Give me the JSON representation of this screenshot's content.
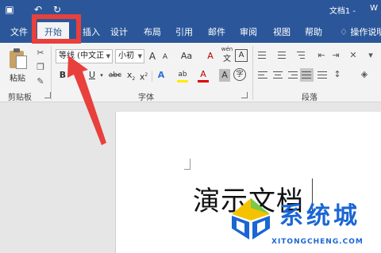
{
  "titlebar": {
    "title": "文档1 -",
    "title_suffix": "W",
    "icons": [
      "save-icon",
      "undo-icon",
      "redo-icon"
    ]
  },
  "tabs": [
    "文件",
    "开始",
    "插入",
    "设计",
    "布局",
    "引用",
    "邮件",
    "审阅",
    "视图",
    "帮助"
  ],
  "active_tab": "开始",
  "tell_me": "操作说明",
  "ribbon": {
    "clipboard": {
      "paste_label": "粘贴",
      "group_label": "剪贴板"
    },
    "font": {
      "font_name": "等线 (中文正",
      "font_size": "小初",
      "grow": "A",
      "shrink": "A",
      "case": "Aa",
      "clear": "A",
      "phonetic": "wén",
      "phonetic_glyph": "文",
      "bold": "B",
      "italic": "I",
      "underline": "U",
      "strike": "abc",
      "subscript": "x",
      "superscript": "x",
      "effects": "A",
      "highlight": "ab",
      "color": "A",
      "shade": "A",
      "enclose": "字",
      "group_label": "字体"
    },
    "paragraph": {
      "group_label": "段落"
    }
  },
  "document": {
    "text": "演示文档"
  },
  "watermark": {
    "text": "系统城",
    "url": "XITONGCHENG.COM"
  },
  "colors": {
    "word_blue": "#2b579a",
    "highlight_red": "#e8403c",
    "watermark_blue": "#1a66d4"
  }
}
